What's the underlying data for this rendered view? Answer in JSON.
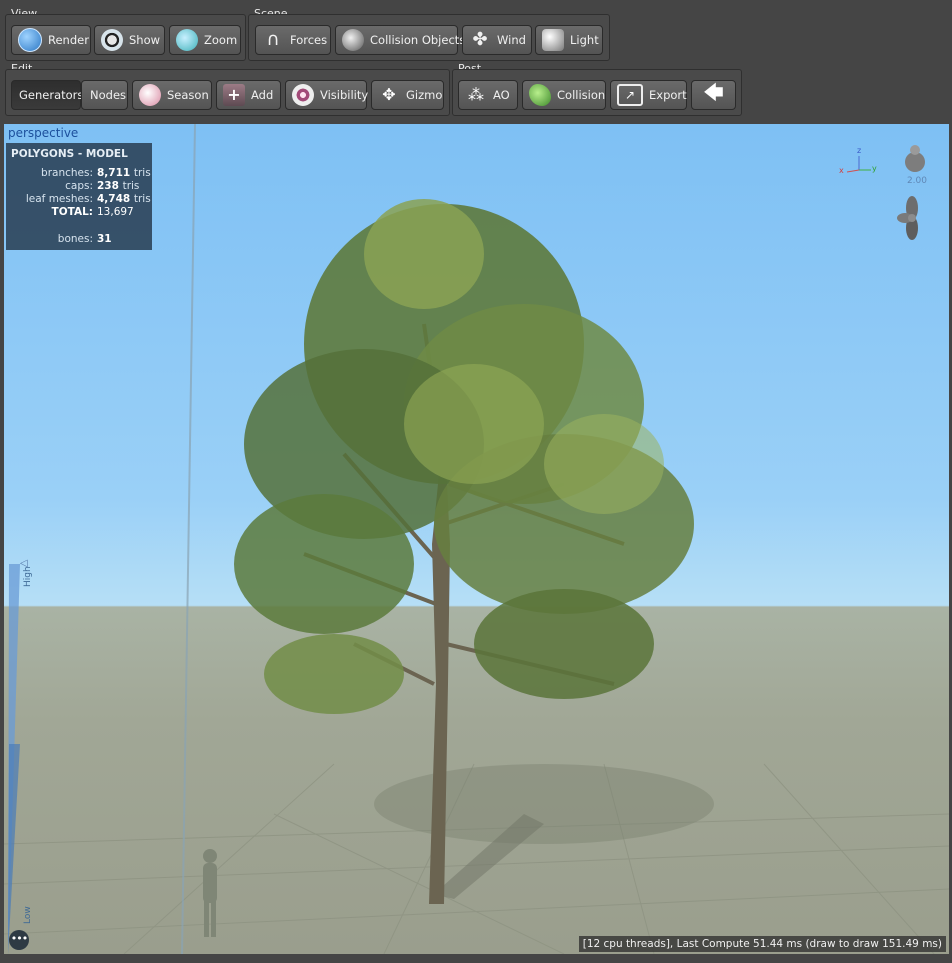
{
  "toolbar": {
    "view": {
      "title": "View",
      "buttons": [
        {
          "label": "Render",
          "icon": "globe-icon"
        },
        {
          "label": "Show",
          "icon": "eye-icon"
        },
        {
          "label": "Zoom",
          "icon": "magnifier-icon"
        }
      ]
    },
    "scene": {
      "title": "Scene",
      "buttons": [
        {
          "label": "Forces",
          "icon": "magnet-icon"
        },
        {
          "label": "Collision Objects",
          "icon": "collision-sphere-icon"
        },
        {
          "label": "Wind",
          "icon": "fan-icon"
        },
        {
          "label": "Light",
          "icon": "light-icon"
        }
      ]
    },
    "edit": {
      "title": "Edit",
      "buttons": [
        {
          "label": "Generators",
          "active": true
        },
        {
          "label": "Nodes"
        },
        {
          "label": "Season",
          "icon": "season-icon"
        },
        {
          "label": "Add",
          "icon": "add-icon"
        },
        {
          "label": "Visibility",
          "icon": "visibility-icon"
        },
        {
          "label": "Gizmo",
          "icon": "gizmo-icon"
        }
      ]
    },
    "post": {
      "title": "Post",
      "buttons": [
        {
          "label": "AO",
          "icon": "ao-icon"
        },
        {
          "label": "Collision",
          "icon": "leaf-collision-icon"
        },
        {
          "label": "Export",
          "icon": "export-icon"
        },
        {
          "label": "",
          "icon": "back-arrow-icon"
        }
      ]
    }
  },
  "viewport": {
    "camera": "perspective",
    "stats": {
      "title": "POLYGONS - MODEL",
      "rows": [
        {
          "label": "branches:",
          "value": "8,711",
          "unit": "tris"
        },
        {
          "label": "caps:",
          "value": "238",
          "unit": "tris"
        },
        {
          "label": "leaf meshes:",
          "value": "4,748",
          "unit": "tris"
        },
        {
          "label": "TOTAL:",
          "value": "13,697",
          "unit": ""
        }
      ],
      "bones_label": "bones:",
      "bones_value": "31"
    },
    "axes": {
      "z": "z",
      "x": "x",
      "y": "y"
    },
    "scale_value": "2.00",
    "lod": {
      "high": "High",
      "low": "Low"
    },
    "more_label": "•••",
    "status": "[12 cpu threads], Last Compute 51.44 ms (draw to draw 151.49 ms)"
  }
}
